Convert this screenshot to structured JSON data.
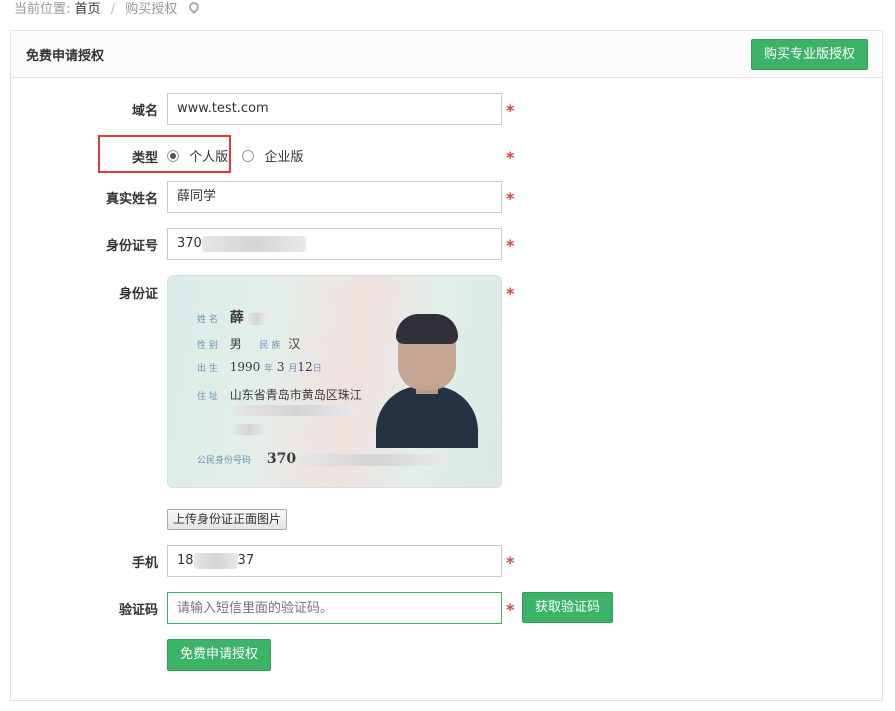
{
  "breadcrumb": {
    "prefix": "当前位置:",
    "home": "首页",
    "separator": "/",
    "current": "购买授权"
  },
  "panel": {
    "title": "免费申请授权",
    "buy_button": "购买专业版授权"
  },
  "form": {
    "domain": {
      "label": "域名",
      "value": "www.test.com"
    },
    "type": {
      "label": "类型",
      "options": [
        "个人版",
        "企业版"
      ],
      "selected": "个人版"
    },
    "name": {
      "label": "真实姓名",
      "value": "薛同学"
    },
    "id_number": {
      "label": "身份证号",
      "value_visible": "370"
    },
    "id_card": {
      "label": "身份证",
      "name_label": "姓 名",
      "name_value": "薛",
      "gender_label": "性 别",
      "gender_value": "男",
      "ethnicity_label": "民 族",
      "ethnicity_value": "汉",
      "birth_label": "出 生",
      "birth_year": "1990",
      "year_unit": "年",
      "birth_month": "3",
      "month_unit": "月",
      "birth_day": "12",
      "day_unit": "日",
      "address_label": "住 址",
      "address_value": "山东省青岛市黄岛区珠江",
      "number_label": "公民身份号码",
      "number_value": "370"
    },
    "upload_button": "上传身份证正面图片",
    "phone": {
      "label": "手机",
      "value_prefix": "18",
      "value_suffix": "37"
    },
    "code": {
      "label": "验证码",
      "placeholder": "请输入短信里面的验证码。",
      "get_code_button": "获取验证码"
    },
    "submit_button": "免费申请授权",
    "required_mark": "*"
  },
  "colors": {
    "accent": "#3db36a",
    "required": "#e0413c",
    "highlight_box": "#e53935"
  }
}
